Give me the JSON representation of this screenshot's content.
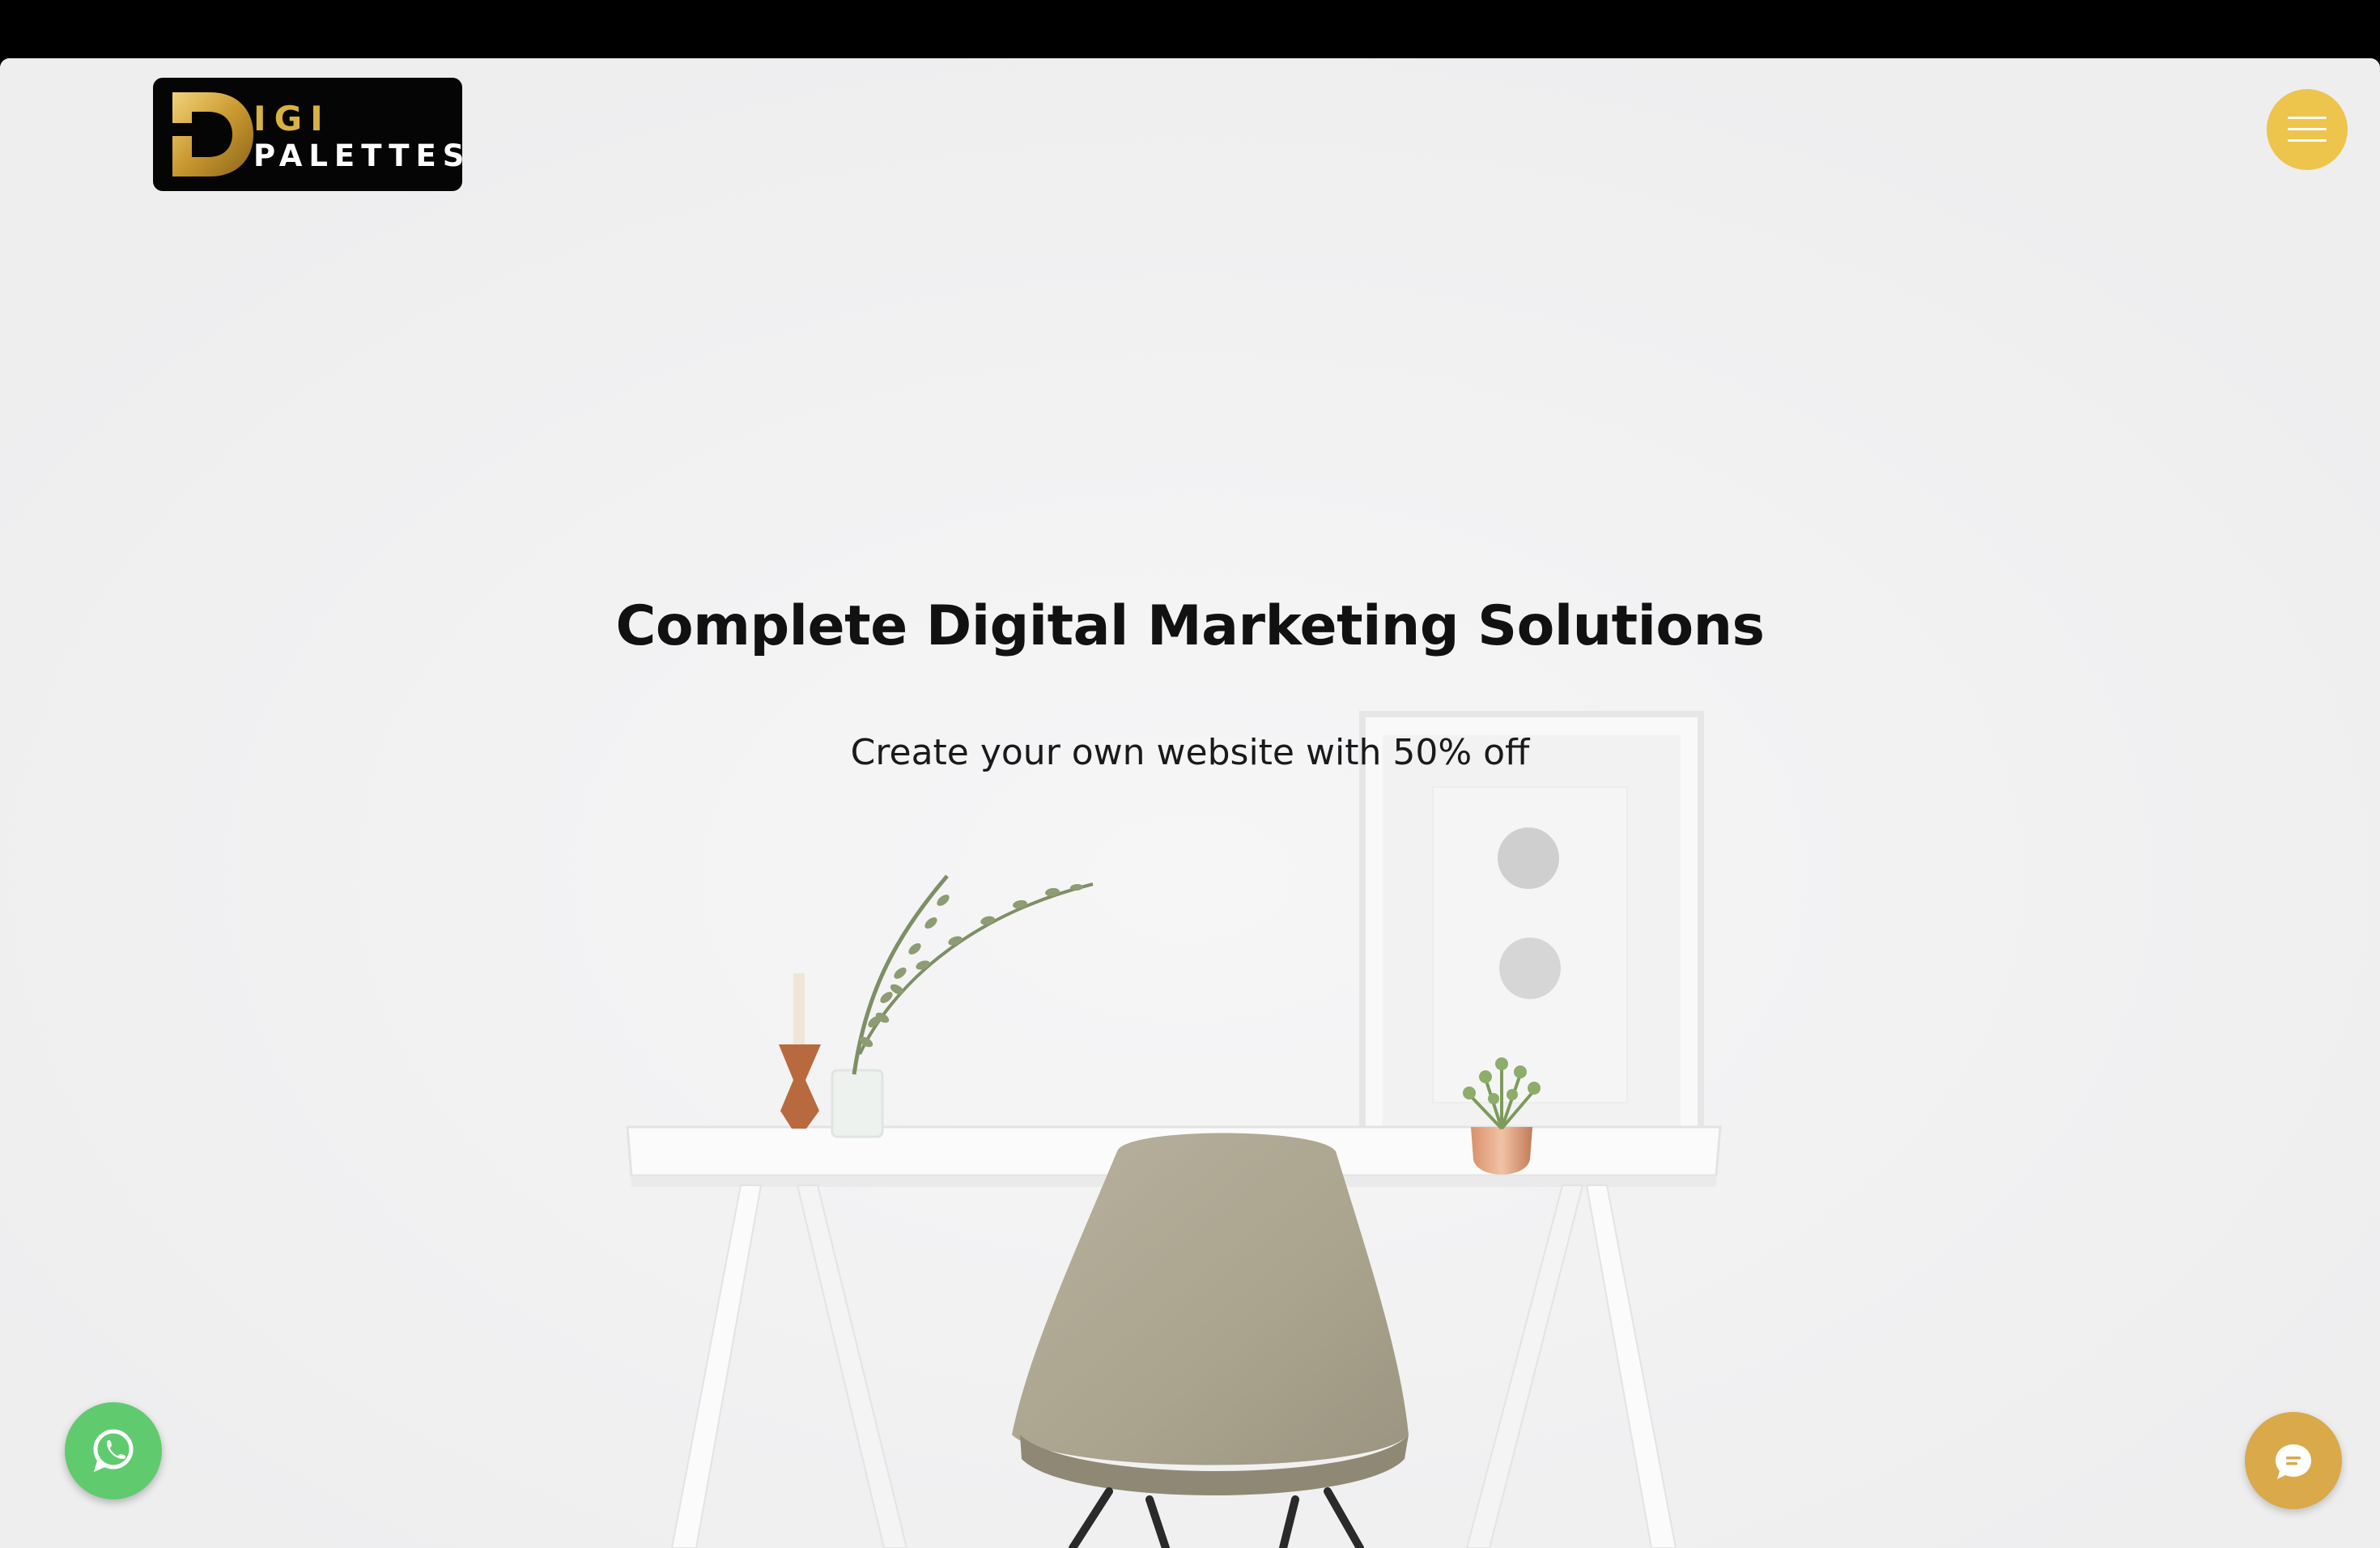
{
  "header": {
    "logo": {
      "text_top": "IGI",
      "text_bottom": "PALETTES",
      "gold": "#d9b143",
      "background": "#050505"
    },
    "menu_icon": "hamburger-menu-icon",
    "menu_color": "#edc44c"
  },
  "hero": {
    "title": "Complete Digital Marketing Solutions",
    "subtitle": "Create your own website with 50% off",
    "background_image": "minimal white desk with beige chair, plant vase, candle and framed picture"
  },
  "floating": {
    "whatsapp_icon": "whatsapp-icon",
    "whatsapp_color": "#5fcb6e",
    "chat_icon": "chat-bubble-icon",
    "chat_color": "#d9a94a"
  }
}
